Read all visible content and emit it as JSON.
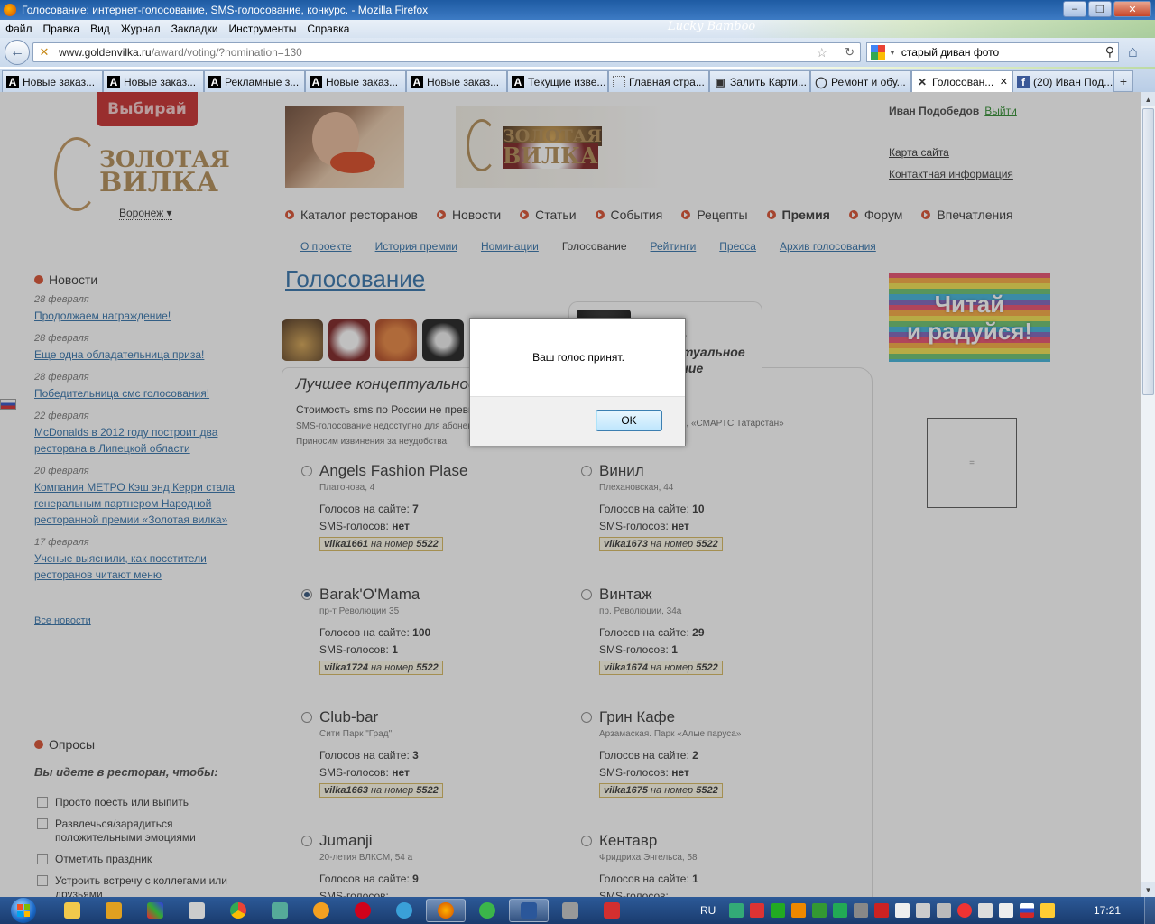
{
  "window": {
    "title": "Голосование: интернет-голосование, SMS-голосование, конкурс. - Mozilla Firefox",
    "theme_name": "Lucky Bamboo",
    "buttons": [
      "–",
      "❐",
      "✕"
    ]
  },
  "menu": [
    "Файл",
    "Правка",
    "Вид",
    "Журнал",
    "Закладки",
    "Инструменты",
    "Справка"
  ],
  "address": {
    "domain": "www.goldenvilka.ru",
    "path": "/award/voting/?nomination=130"
  },
  "search": {
    "value": "старый диван фото"
  },
  "tabs": [
    {
      "label": "Новые заказ...",
      "icon": "A"
    },
    {
      "label": "Новые заказ...",
      "icon": "A"
    },
    {
      "label": "Рекламные з...",
      "icon": "A"
    },
    {
      "label": "Новые заказ...",
      "icon": "A"
    },
    {
      "label": "Новые заказ...",
      "icon": "A"
    },
    {
      "label": "Текущие изве...",
      "icon": "A"
    },
    {
      "label": "Главная стра...",
      "icon": ""
    },
    {
      "label": "Залить Карти...",
      "icon": ""
    },
    {
      "label": "Ремонт и обу...",
      "icon": ""
    },
    {
      "label": "Голосован...",
      "icon": "",
      "active": true
    },
    {
      "label": "(20) Иван Под...",
      "icon": "f"
    }
  ],
  "site": {
    "badge": "Выбирай",
    "logo_line1": "ЗОЛОТАЯ",
    "logo_line2": "ВИЛКА",
    "city": "Воронеж ▾",
    "banner_logo1": "ЗОЛОТАЯ",
    "banner_logo2": "ВИЛКА",
    "user_name": "Иван Подобедов",
    "logout": "Выйти",
    "top_links": [
      "Карта сайта",
      "Контактная информация"
    ]
  },
  "main_menu": [
    {
      "label": "Каталог ресторанов"
    },
    {
      "label": "Новости"
    },
    {
      "label": "Статьи"
    },
    {
      "label": "События"
    },
    {
      "label": "Рецепты"
    },
    {
      "label": "Премия",
      "active": true
    },
    {
      "label": "Форум"
    },
    {
      "label": "Впечатления"
    }
  ],
  "sub_menu": [
    {
      "label": "О проекте"
    },
    {
      "label": "История премии"
    },
    {
      "label": "Номинации"
    },
    {
      "label": "Голосование",
      "current": true
    },
    {
      "label": "Рейтинги"
    },
    {
      "label": "Пресса"
    },
    {
      "label": "Архив голосования"
    }
  ],
  "news": {
    "title": "Новости",
    "items": [
      {
        "date": "28 февраля",
        "text": "Продолжаем награждение!"
      },
      {
        "date": "28 февраля",
        "text": "Еще одна обладательница приза!"
      },
      {
        "date": "28 февраля",
        "text": "Победительница смс голосования!"
      },
      {
        "date": "22 февраля",
        "text": "McDonalds в 2012 году построит два ресторана в Липецкой области"
      },
      {
        "date": "20 февраля",
        "text": "Компания МЕТРО Кэш энд Керри стала генеральным партнером Народной ресторанной премии «Золотая вилка»"
      },
      {
        "date": "17 февраля",
        "text": "Ученые выяснили, как посетители ресторанов читают меню"
      }
    ],
    "all_link": "Все новости"
  },
  "poll": {
    "title": "Опросы",
    "question": "Вы идете в ресторан, чтобы:",
    "options": [
      "Просто поесть или выпить",
      "Развлечься/зарядиться положительными эмоциями",
      "Отметить праздник",
      "Устроить встречу с коллегами или друзьями"
    ]
  },
  "voting": {
    "title": "Голосование",
    "active_tab_label": "Лучшее концептуальное заведение",
    "nomination": "Лучшее концептуальное заведение",
    "cost": "Стоимость sms по России не превышает 5 рублей",
    "note1": "SMS-голосование недоступно для абонентов",
    "note2": "Приносим извинения за неудобства.",
    "note_right": "м», «СМАРТС Татарстан»",
    "votes_site_label": "Голосов на сайте:",
    "votes_sms_label": "SMS-голосов:",
    "code_mid": "на номер",
    "candidates": [
      {
        "name": "Angels Fashion Plase",
        "address": "Платонова, 4",
        "site_votes": "7",
        "sms_votes": "нет",
        "code": "vilka1661",
        "number": "5522",
        "selected": false
      },
      {
        "name": "Винил",
        "address": "Плехановская, 44",
        "site_votes": "10",
        "sms_votes": "нет",
        "code": "vilka1673",
        "number": "5522",
        "selected": false
      },
      {
        "name": "Barak'O'Mama",
        "address": "пр-т Революции 35",
        "site_votes": "100",
        "sms_votes": "1",
        "code": "vilka1724",
        "number": "5522",
        "selected": true
      },
      {
        "name": "Винтаж",
        "address": "пр. Революции, 34а",
        "site_votes": "29",
        "sms_votes": "1",
        "code": "vilka1674",
        "number": "5522",
        "selected": false
      },
      {
        "name": "Club-bar",
        "address": "Сити Парк \"Град\"",
        "site_votes": "3",
        "sms_votes": "нет",
        "code": "vilka1663",
        "number": "5522",
        "selected": false
      },
      {
        "name": "Грин Кафе",
        "address": "Арзамаская. Парк «Алые паруса»",
        "site_votes": "2",
        "sms_votes": "нет",
        "code": "vilka1675",
        "number": "5522",
        "selected": false
      },
      {
        "name": "Jumanji",
        "address": "20-летия ВЛКСМ, 54 а",
        "site_votes": "9",
        "sms_votes": "",
        "code": "",
        "number": "",
        "selected": false
      },
      {
        "name": "Кентавр",
        "address": "Фридриха Энгельса, 58",
        "site_votes": "1",
        "sms_votes": "",
        "code": "",
        "number": "",
        "selected": false
      }
    ]
  },
  "ad": {
    "line1": "Читай",
    "line2": "и радуйся!"
  },
  "dialog": {
    "message": "Ваш голос принят.",
    "ok": "OK"
  },
  "taskbar": {
    "lang": "RU",
    "time": "17:21"
  }
}
